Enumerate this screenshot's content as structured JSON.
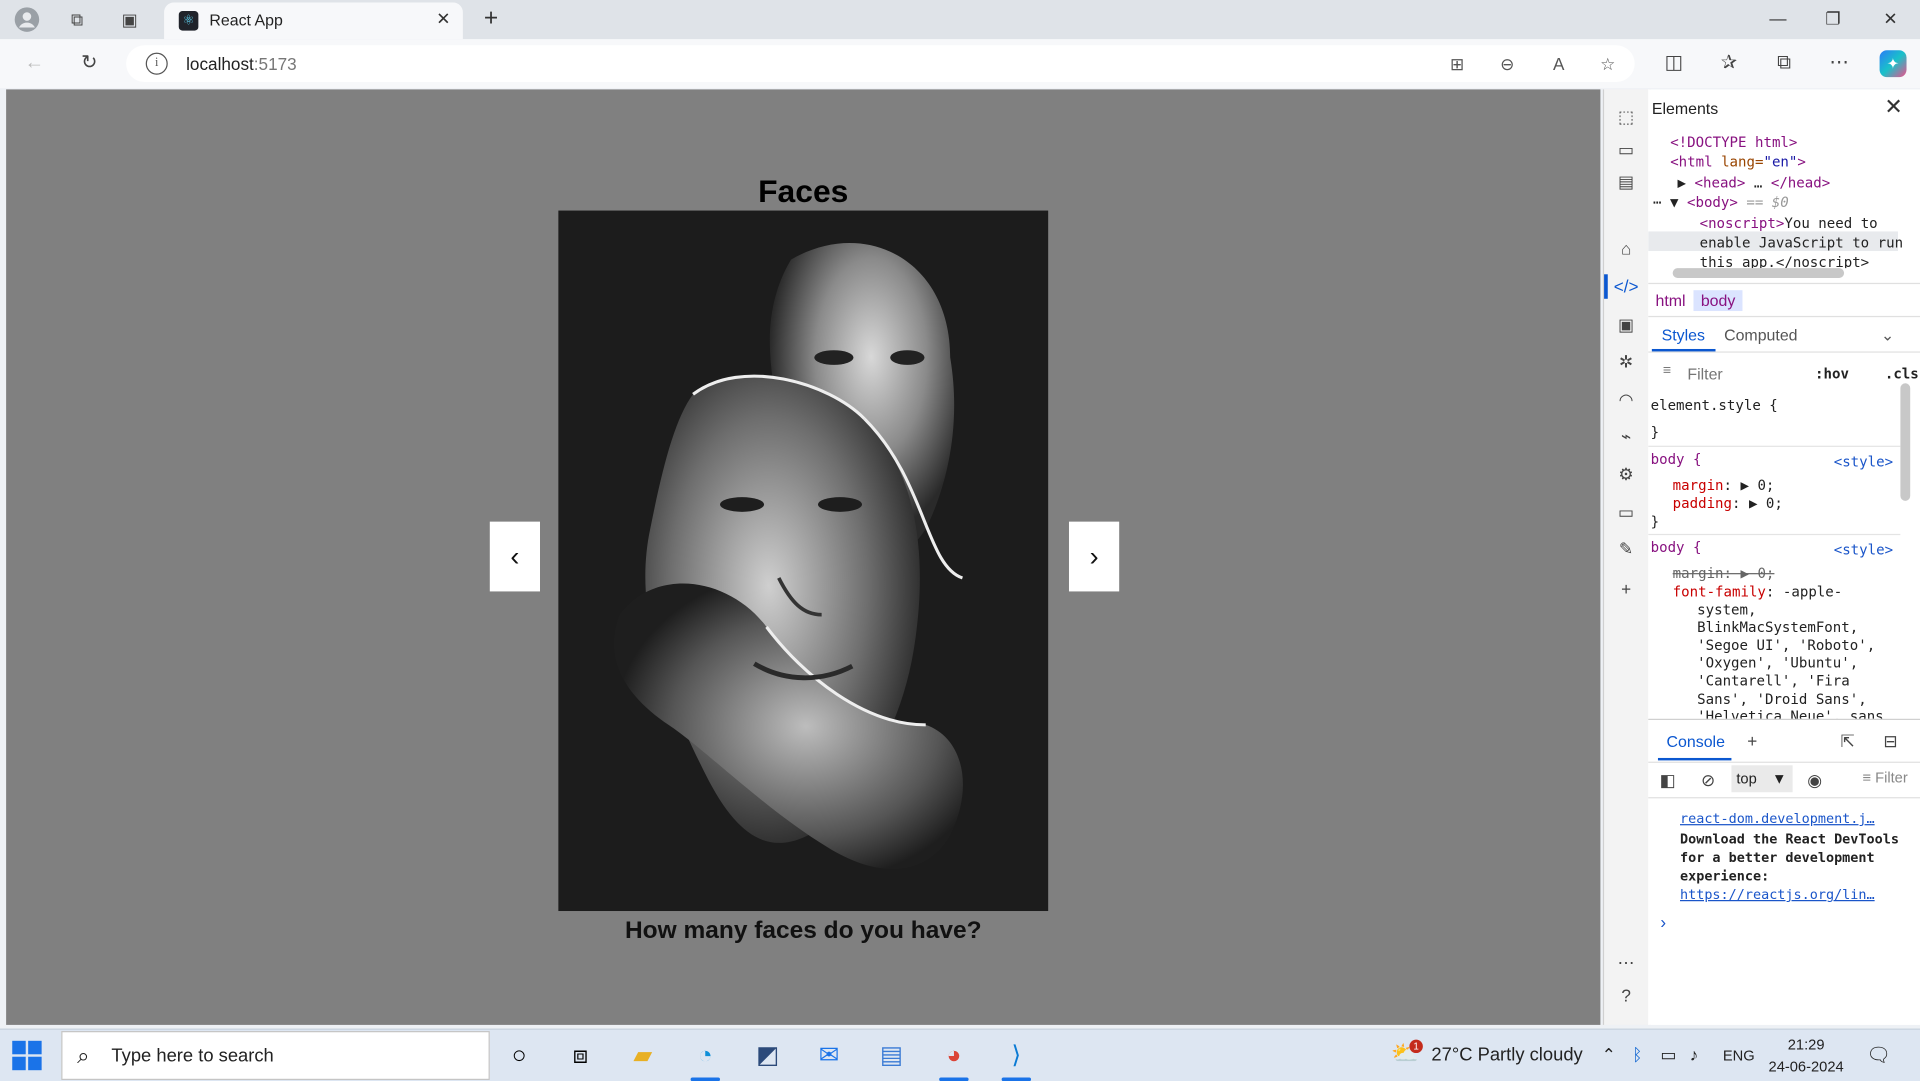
{
  "browser": {
    "tab_title": "React App",
    "url_host": "localhost",
    "url_port": ":5173"
  },
  "page": {
    "title": "Faces",
    "caption": "How many faces do you have?",
    "prev_label": "‹",
    "next_label": "›"
  },
  "devtools": {
    "panel_title": "Elements",
    "dom": {
      "doctype": "<!DOCTYPE html>",
      "html_open": "<html ",
      "html_attr": "lang=",
      "html_val": "\"en\"",
      "head": "<head>",
      "head_ellipsis": " … ",
      "head_close": "</head>",
      "body": "<body>",
      "body_sel": " == $0",
      "noscript": "<noscript>",
      "noscript_text1": "You need to",
      "noscript_text2": "enable JavaScript to run",
      "noscript_text3": "this app.</noscript>"
    },
    "breadcrumbs": [
      "html",
      "body"
    ],
    "subtabs": [
      "Styles",
      "Computed"
    ],
    "filter_placeholder": "Filter",
    "hov": ":hov",
    ".cls": ".cls",
    "cls": ".cls",
    "styles": {
      "element_style": "element.style {",
      "close": "}",
      "body_sel": "body {",
      "source": "<style>",
      "margin": "margin",
      "margin_val": "0;",
      "padding": "padding",
      "padding_val": "0;",
      "font_family": "font-family",
      "font_lines": [
        "-apple-",
        "system,",
        "BlinkMacSystemFont,",
        "'Segoe UI', 'Roboto',",
        "'Oxygen', 'Ubuntu',",
        "'Cantarell', 'Fira",
        "Sans', 'Droid Sans',",
        "'Helvetica Neue', sans"
      ]
    },
    "console_tab": "Console",
    "context": "top",
    "console_filter": "Filter",
    "console": {
      "source_link": "react-dom.development.j…",
      "message": "Download the React DevTools for a better development experience:",
      "link": "https://reactjs.org/lin…"
    }
  },
  "taskbar": {
    "search_placeholder": "Type here to search",
    "weather": "27°C  Partly cloudy",
    "weather_badge": "1",
    "lang": "ENG",
    "time": "21:29",
    "date": "24-06-2024"
  }
}
